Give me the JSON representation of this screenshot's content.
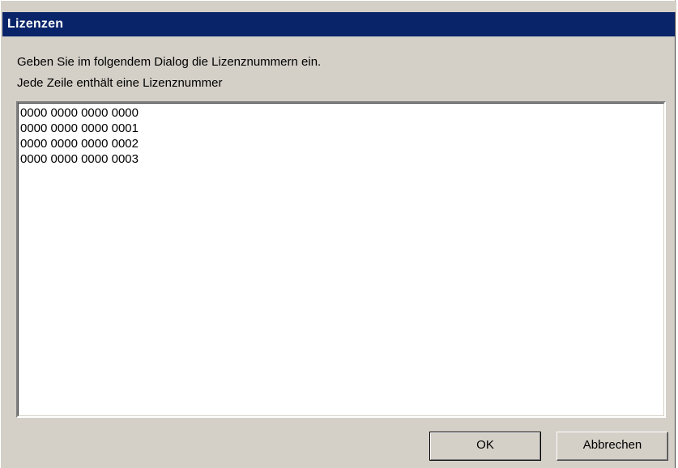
{
  "window": {
    "title": "Lizenzen"
  },
  "instructions": {
    "line1": "Geben Sie im folgendem Dialog die Lizenznummern ein.",
    "line2": "Jede Zeile enthält eine Lizenznummer"
  },
  "license_list": {
    "lines": [
      "0000 0000 0000 0000",
      "0000 0000 0000 0001",
      "0000 0000 0000 0002",
      "0000 0000 0000 0003"
    ]
  },
  "buttons": {
    "ok_label": "OK",
    "cancel_label": "Abbrechen"
  },
  "colors": {
    "titlebar": "#0a246a",
    "dialog_face": "#d4d0c8"
  }
}
